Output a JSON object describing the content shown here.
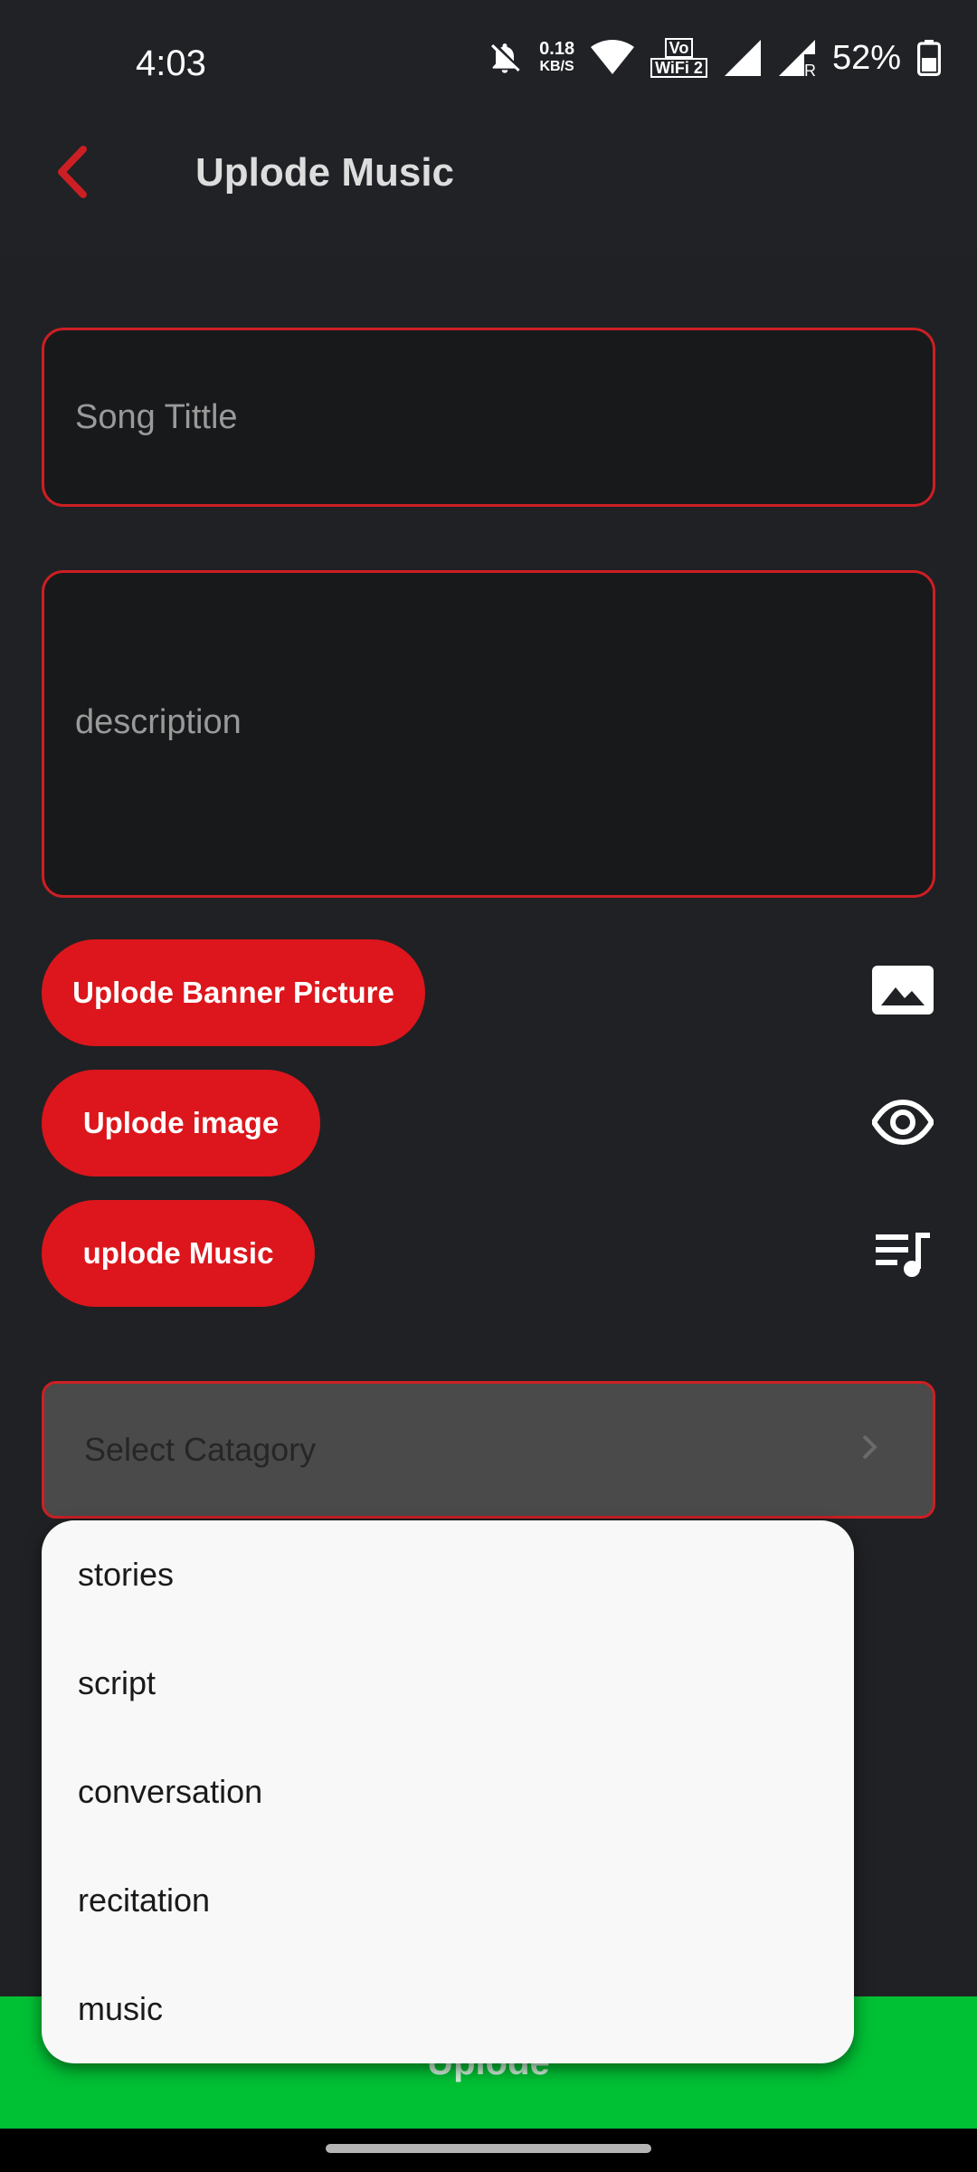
{
  "status_bar": {
    "time": "4:03",
    "net_speed_value": "0.18",
    "net_speed_unit": "KB/S",
    "volte_label": "Vo",
    "wifi_label": "WiFi 2",
    "battery": "52%"
  },
  "app_bar": {
    "title": "Uplode Music",
    "back_icon": "back-arrow-icon",
    "accent_color": "#cc1f24"
  },
  "form": {
    "title_placeholder": "Song Tittle",
    "description_placeholder": "description",
    "banner_button": "Uplode Banner Picture",
    "image_button": "Uplode  image",
    "music_button": "uplode  Music",
    "banner_icon": "image-icon",
    "image_icon": "eye-icon",
    "music_icon": "playlist-music-icon",
    "category_placeholder": "Select Catagory",
    "category_options": [
      "stories",
      "script",
      "conversation",
      "recitation",
      "music"
    ],
    "submit_label": "Uplode",
    "submit_color": "#00c034"
  }
}
